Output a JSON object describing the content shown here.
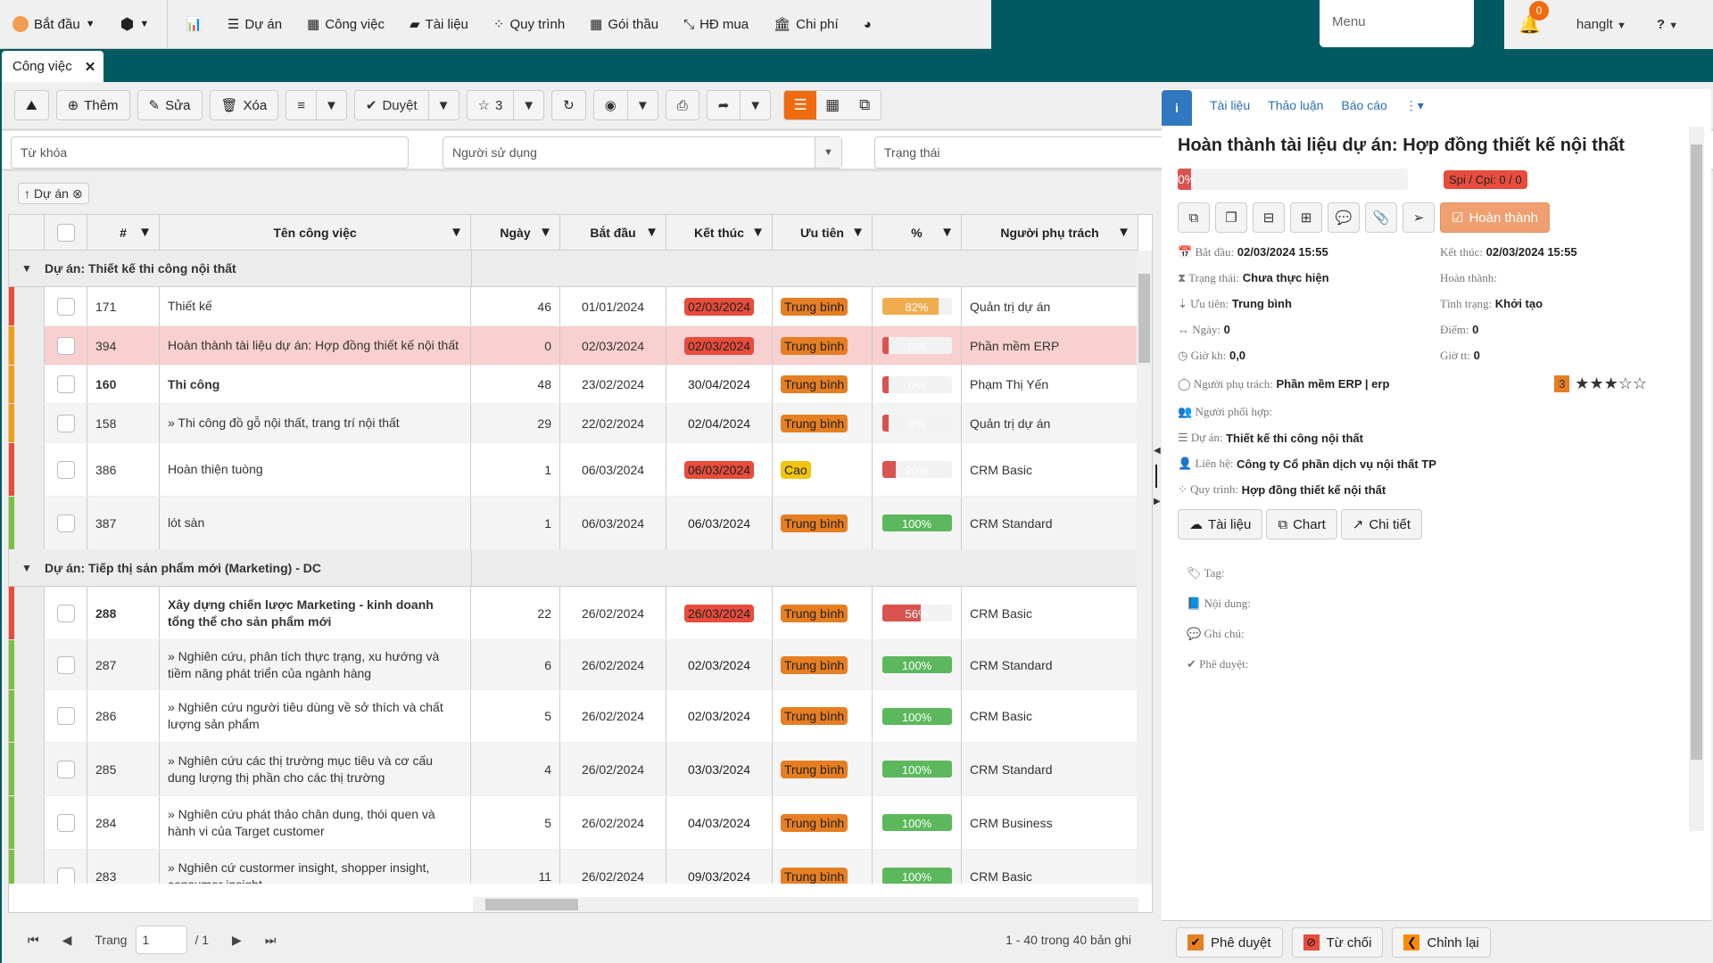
{
  "topmenu": {
    "start": "Bắt đầu",
    "items": [
      "Dự án",
      "Công việc",
      "Tài liệu",
      "Quy trình",
      "Gói thầu",
      "HĐ mua",
      "Chi phí"
    ],
    "menu_placeholder": "Menu",
    "notifications": "0",
    "user": "hanglt"
  },
  "tab": {
    "label": "Công việc"
  },
  "toolbar": {
    "add": "Thêm",
    "edit": "Sửa",
    "delete": "Xóa",
    "approve": "Duyệt",
    "star_count": "3"
  },
  "filters": {
    "keyword": "Từ khóa",
    "user": "Người sử dụng",
    "status": "Trạng thái"
  },
  "group_chip": "Dự án",
  "grid": {
    "headers": [
      "#",
      "Tên công việc",
      "Ngày",
      "Bắt đầu",
      "Kết thúc",
      "Ưu tiên",
      "%",
      "Người phụ trách"
    ],
    "groups": [
      {
        "label": "Dự án: Thiết kế thi công nội thất",
        "rows": [
          {
            "id": "171",
            "name": "Thiết kế",
            "days": "46",
            "start": "01/01/2024",
            "end": "02/03/2024",
            "end_overdue": true,
            "priority": "Trung bình",
            "pct": 82,
            "pct_label": "82%",
            "owner": "Quản trị dự án",
            "stripe": "#e74c3c",
            "bold": false,
            "sel": false,
            "h": 44
          },
          {
            "id": "394",
            "name": "Hoàn thành tài liệu dự án: Hợp đồng thiết kế nội thất",
            "days": "0",
            "start": "02/03/2024",
            "end": "02/03/2024",
            "end_overdue": true,
            "priority": "Trung bình",
            "pct": 0,
            "pct_label": "0%",
            "owner": "Phần mềm ERP",
            "stripe": "#f39c12",
            "bold": false,
            "sel": true,
            "h": 44
          },
          {
            "id": "160",
            "name": "Thi công",
            "days": "48",
            "start": "23/02/2024",
            "end": "30/04/2024",
            "end_overdue": false,
            "priority": "Trung bình",
            "pct": 0,
            "pct_label": "0%",
            "owner": "Phạm Thị Yến",
            "stripe": "#f39c12",
            "bold": true,
            "sel": false,
            "h": 43
          },
          {
            "id": "158",
            "name": "» Thi công đồ gỗ nội thất, trang trí nội thất",
            "days": "29",
            "start": "22/02/2024",
            "end": "02/04/2024",
            "end_overdue": false,
            "priority": "Trung bình",
            "pct": 0,
            "pct_label": "0%",
            "owner": "Quản trị dự án",
            "stripe": "#f39c12",
            "bold": false,
            "sel": false,
            "h": 44
          },
          {
            "id": "386",
            "name": "Hoàn thiện tuòng",
            "days": "1",
            "start": "06/03/2024",
            "end": "06/03/2024",
            "end_overdue": true,
            "priority": "Cao",
            "pct": 20,
            "pct_label": "20%",
            "owner": "CRM Basic",
            "stripe": "#e74c3c",
            "bold": false,
            "sel": false,
            "h": 60
          },
          {
            "id": "387",
            "name": "lót sàn",
            "days": "1",
            "start": "06/03/2024",
            "end": "06/03/2024",
            "end_overdue": false,
            "priority": "Trung bình",
            "pct": 100,
            "pct_label": "100%",
            "owner": "CRM Standard",
            "stripe": "#7bc043",
            "bold": false,
            "sel": false,
            "h": 60
          }
        ]
      },
      {
        "label": "Dự án: Tiếp thị sản phẩm mới (Marketing) - DC",
        "rows": [
          {
            "id": "288",
            "name": "Xây dựng chiến lược Marketing - kinh doanh tổng thể cho sản phẩm mới",
            "days": "22",
            "start": "26/02/2024",
            "end": "26/03/2024",
            "end_overdue": true,
            "priority": "Trung bình",
            "pct": 56,
            "pct_label": "56%",
            "owner": "CRM Basic",
            "stripe": "#e74c3c",
            "bold": true,
            "sel": false,
            "h": 60
          },
          {
            "id": "287",
            "name": "» Nghiên cứu, phân tích thực trạng, xu hướng và tiềm năng phát triển của ngành hàng",
            "days": "6",
            "start": "26/02/2024",
            "end": "02/03/2024",
            "end_overdue": false,
            "priority": "Trung bình",
            "pct": 100,
            "pct_label": "100%",
            "owner": "CRM Standard",
            "stripe": "#7bc043",
            "bold": false,
            "sel": false,
            "h": 56
          },
          {
            "id": "286",
            "name": "» Nghiên cứu người tiêu dùng về sở thích và chất lượng sản phẩm",
            "days": "5",
            "start": "26/02/2024",
            "end": "02/03/2024",
            "end_overdue": false,
            "priority": "Trung bình",
            "pct": 100,
            "pct_label": "100%",
            "owner": "CRM Basic",
            "stripe": "#7bc043",
            "bold": false,
            "sel": false,
            "h": 59
          },
          {
            "id": "285",
            "name": "» Nghiên cứu các thị trường mục tiêu và cơ cấu dung lượng thị phần cho các thị trường",
            "days": "4",
            "start": "26/02/2024",
            "end": "03/03/2024",
            "end_overdue": false,
            "priority": "Trung bình",
            "pct": 100,
            "pct_label": "100%",
            "owner": "CRM Standard",
            "stripe": "#7bc043",
            "bold": false,
            "sel": false,
            "h": 60
          },
          {
            "id": "284",
            "name": "» Nghiên cứu phát thảo chân dung, thói quen và hành vi của Target customer",
            "days": "5",
            "start": "26/02/2024",
            "end": "04/03/2024",
            "end_overdue": false,
            "priority": "Trung bình",
            "pct": 100,
            "pct_label": "100%",
            "owner": "CRM Business",
            "stripe": "#7bc043",
            "bold": false,
            "sel": false,
            "h": 60
          },
          {
            "id": "283",
            "name": "» Nghiên cứ custormer insight, shopper insight, consumer insight",
            "days": "11",
            "start": "26/02/2024",
            "end": "09/03/2024",
            "end_overdue": false,
            "priority": "Trung bình",
            "pct": 100,
            "pct_label": "100%",
            "owner": "CRM Basic",
            "stripe": "#7bc043",
            "bold": false,
            "sel": false,
            "h": 60
          }
        ]
      }
    ]
  },
  "pager": {
    "page_label": "Trang",
    "page": "1",
    "total_pages": "/ 1",
    "count": "1 - 40 trong 40 bản ghi"
  },
  "panel": {
    "tabs": [
      "Tài liệu",
      "Thảo luận",
      "Báo cáo"
    ],
    "title": "Hoàn thành tài liệu dự án: Hợp đồng thiết kế nội thất",
    "progress_pct": 0,
    "progress_label": "0%",
    "spi": "Spi / Cpi: 0 / 0",
    "complete_btn": "Hoàn thành",
    "fields": {
      "start_l": "Bắt đầu:",
      "start": "02/03/2024 15:55",
      "end_l": "Kết thúc:",
      "end": "02/03/2024 15:55",
      "status_l": "Trạng thái:",
      "status": "Chưa thực hiện",
      "done_l": "Hoàn thành:",
      "done": "",
      "prio_l": "Ưu tiên:",
      "prio": "Trung bình",
      "cond_l": "Tình trạng:",
      "cond": "Khởi tạo",
      "days_l": "Ngày:",
      "days": "0",
      "score_l": "Điểm:",
      "score": "0",
      "plan_l": "Giờ kh:",
      "plan": "0,0",
      "actual_l": "Giờ tt:",
      "actual": "0",
      "owner_l": "Người phụ trách:",
      "owner": "Phần mềm ERP | erp",
      "collab_l": "Người phối hợp:",
      "collab": "",
      "project_l": "Dự án:",
      "project": "Thiết kế thi công nội thất",
      "contact_l": "Liên hệ:",
      "contact": "Công ty Cổ phần dịch vụ nội thất TP",
      "process_l": "Quy trình:",
      "process": "Hợp đồng thiết kế nội thất"
    },
    "rating": {
      "value": "3",
      "of": 5
    },
    "buttons": [
      "Tài liệu",
      "Chart",
      "Chi tiết"
    ],
    "extra": [
      "Tag:",
      "Nội dung:",
      "Ghi chú:",
      "Phê duyệt:"
    ],
    "footer": [
      "Phê duyệt",
      "Từ chối",
      "Chỉnh lại"
    ]
  },
  "colors": {
    "brand": "#015a62",
    "accent": "#f06a0f",
    "overdue": "#e74c3c",
    "priority_mid": "#e67e22",
    "priority_high": "#f1c40f",
    "done": "#5cb85c",
    "partial": "#f0ad4e",
    "low": "#d9534f"
  }
}
